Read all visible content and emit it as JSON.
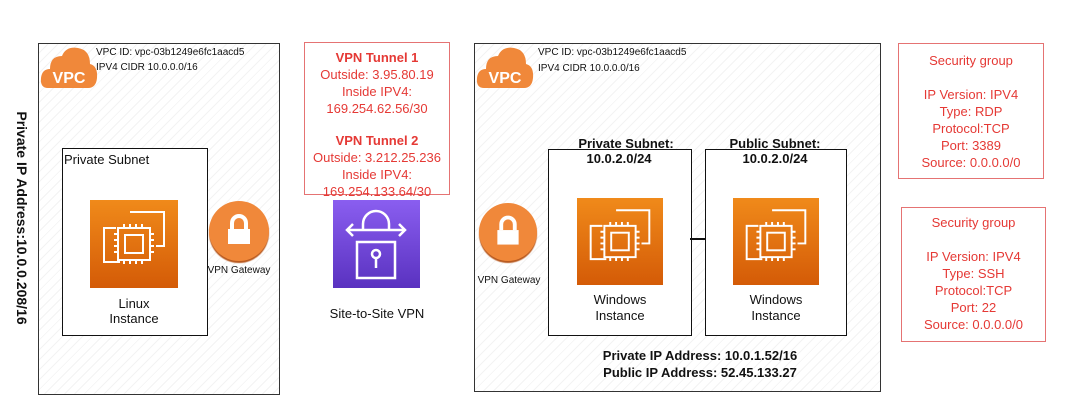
{
  "left_vpc": {
    "vpc_id": "VPC ID: vpc-03b1249e6fc1aacd5",
    "cidr": "IPV4 CIDR 10.0.0.0/16",
    "logo": "VPC",
    "side_label": "Private IP Address:10.0.0.208/16",
    "subnet": {
      "title": "Private Subnet",
      "instance_line1": "Linux",
      "instance_line2": "Instance"
    },
    "gateway": "VPN Gateway"
  },
  "tunnels": {
    "t1_title": "VPN Tunnel 1",
    "t1_outside": "Outside: 3.95.80.19",
    "t1_inside_label": "Inside IPV4:",
    "t1_inside": "169.254.62.56/30",
    "t2_title": "VPN Tunnel 2",
    "t2_outside": "Outside: 3.212.25.236",
    "t2_inside_label": "Inside IPV4:",
    "t2_inside": "169.254.133.64/30"
  },
  "vpn": {
    "label": "Site-to-Site VPN"
  },
  "right_vpc": {
    "vpc_id": "VPC ID: vpc-03b1249e6fc1aacd5",
    "cidr": "IPV4 CIDR 10.0.0.0/16",
    "logo": "VPC",
    "gateway": "VPN Gateway",
    "private_subnet": {
      "title": "Private Subnet:",
      "cidr": "10.0.2.0/24",
      "instance_line1": "Windows",
      "instance_line2": "Instance"
    },
    "public_subnet": {
      "title": "Public Subnet:",
      "cidr": "10.0.2.0/24",
      "instance_line1": "Windows",
      "instance_line2": "Instance"
    },
    "private_ip": "Private IP Address: 10.0.1.52/16",
    "public_ip": "Public IP Address: 52.45.133.27"
  },
  "security_groups": [
    {
      "title": "Security group",
      "ip_version": "IP Version: IPV4",
      "type": "Type: RDP",
      "protocol": "Protocol:TCP",
      "port": "Port: 3389",
      "source": "Source: 0.0.0.0/0"
    },
    {
      "title": "Security group",
      "ip_version": "IP Version: IPV4",
      "type": "Type: SSH",
      "protocol": "Protocol:TCP",
      "port": "Port: 22",
      "source": "Source: 0.0.0.0/0"
    }
  ],
  "colors": {
    "orange": "#f0883a",
    "red": "#e53935",
    "purple": "#7b4ee0"
  }
}
